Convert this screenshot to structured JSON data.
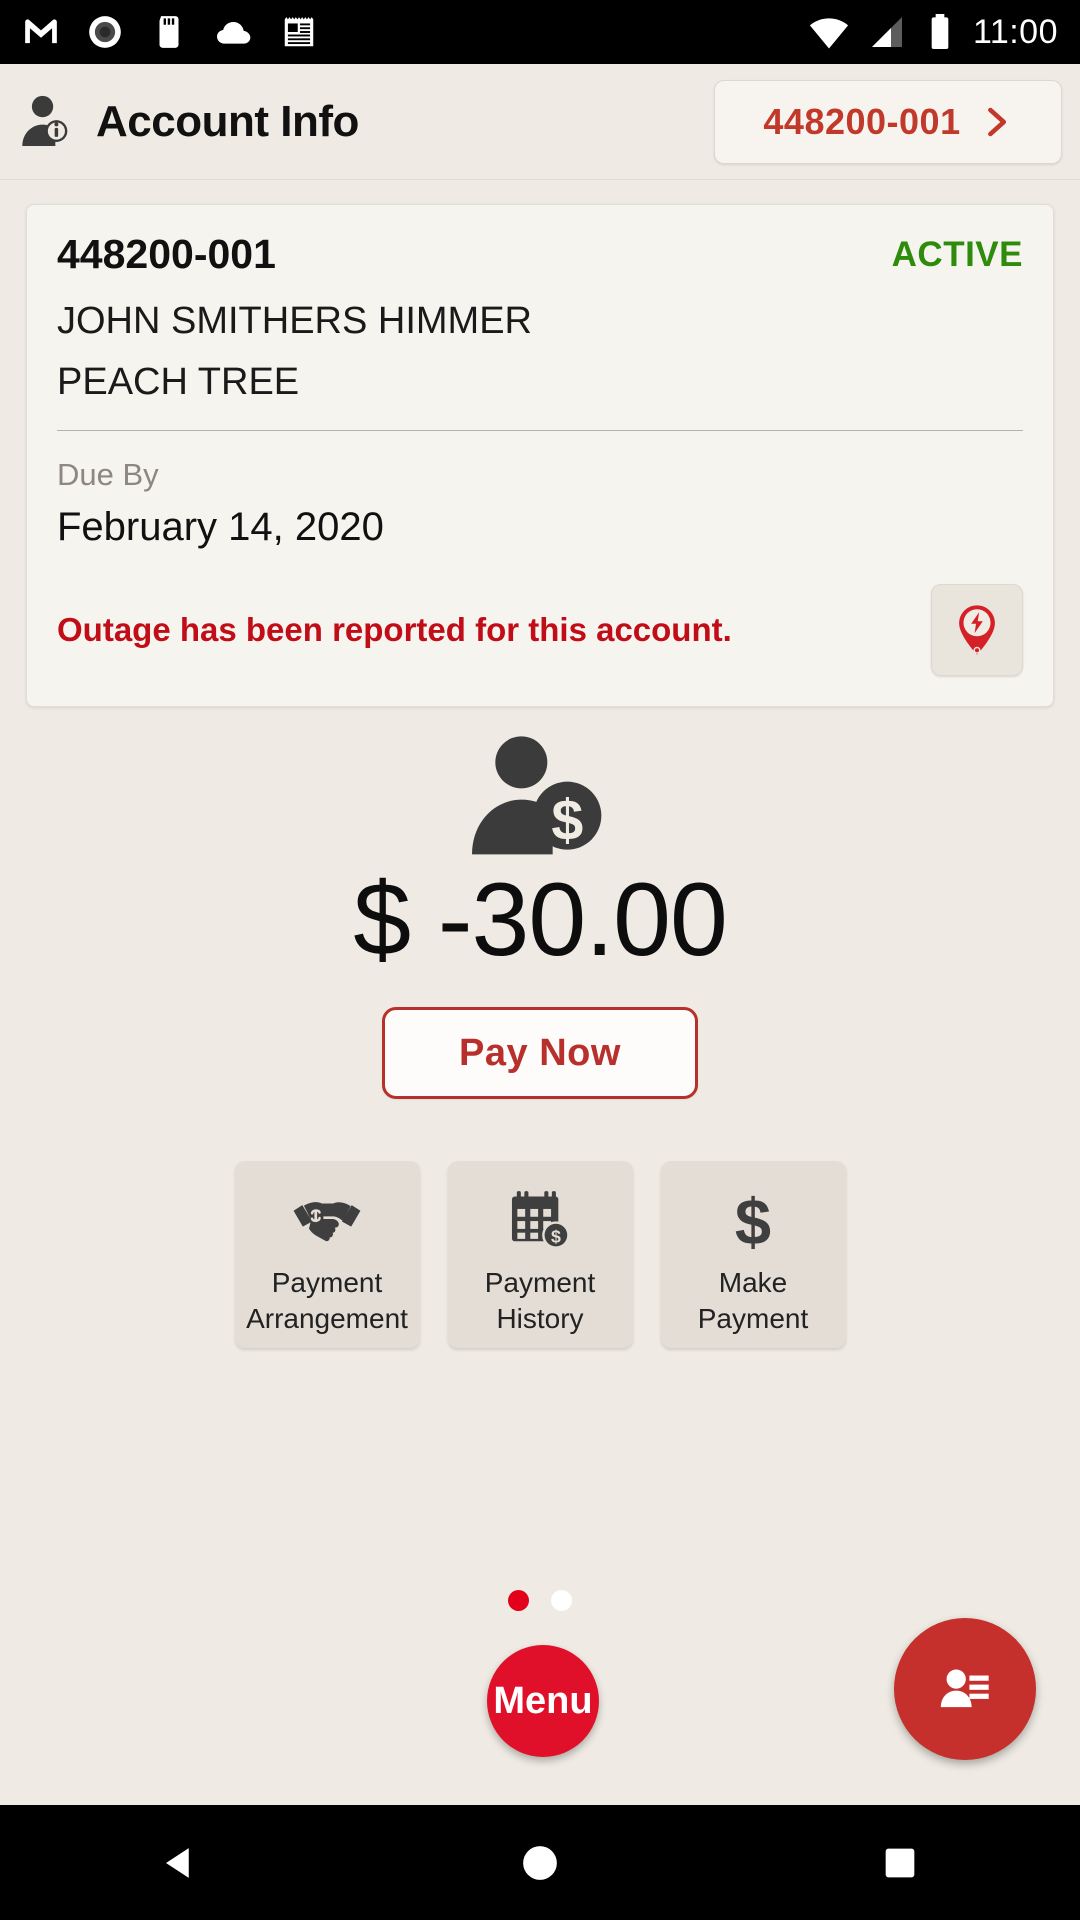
{
  "status_bar": {
    "left_icons": [
      "gmail-icon",
      "record-icon",
      "sd-card-icon",
      "cloud-icon",
      "news-icon"
    ],
    "right_icons": [
      "wifi-icon",
      "cellular-signal-icon",
      "battery-icon"
    ],
    "clock": "11:00"
  },
  "app_bar": {
    "icon": "account-info-icon",
    "title": "Account Info",
    "account_chip": {
      "label": "448200-001",
      "chevron": "chevron-right-icon"
    }
  },
  "account_card": {
    "account_number": "448200-001",
    "status": "ACTIVE",
    "status_color": "#2e8b0c",
    "customer_name": "JOHN SMITHERS HIMMER",
    "address": "PEACH TREE",
    "due_by_label": "Due By",
    "due_by_date": "February 14, 2020",
    "outage_message": "Outage has been reported for this account.",
    "outage_color": "#c10d18",
    "outage_icon": "outage-pin-icon"
  },
  "balance": {
    "icon": "customer-balance-icon",
    "amount": "$ -30.00",
    "pay_now_label": "Pay Now",
    "pay_now_color": "#b8302b"
  },
  "tiles": [
    {
      "icon": "handshake-icon",
      "line1": "Payment",
      "line2": "Arrangement"
    },
    {
      "icon": "calendar-dollar-icon",
      "line1": "Payment",
      "line2": "History"
    },
    {
      "icon": "dollar-sign-icon",
      "line1": "Make",
      "line2": "Payment"
    }
  ],
  "pager": {
    "dots": [
      {
        "active": true,
        "color": "#e3001b"
      },
      {
        "active": false,
        "color": "#ffffff"
      }
    ]
  },
  "fabs": {
    "menu": {
      "label": "Menu",
      "color": "#e1102a"
    },
    "contact": {
      "icon": "contact-card-icon",
      "color": "#c5302c"
    }
  },
  "nav_bar": {
    "back": "back-triangle-icon",
    "home": "home-circle-icon",
    "recents": "recents-square-icon"
  }
}
